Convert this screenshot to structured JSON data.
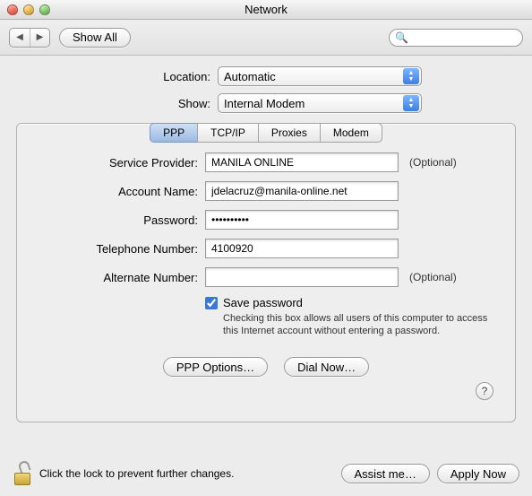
{
  "window": {
    "title": "Network"
  },
  "toolbar": {
    "show_all": "Show All",
    "search_placeholder": ""
  },
  "selectors": {
    "location_label": "Location:",
    "location_value": "Automatic",
    "show_label": "Show:",
    "show_value": "Internal Modem"
  },
  "tabs": {
    "ppp": "PPP",
    "tcpip": "TCP/IP",
    "proxies": "Proxies",
    "modem": "Modem",
    "active": "ppp"
  },
  "form": {
    "service_provider_label": "Service Provider:",
    "service_provider_value": "MANILA ONLINE",
    "account_name_label": "Account Name:",
    "account_name_value": "jdelacruz@manila-online.net",
    "password_label": "Password:",
    "password_value": "••••••••••",
    "telephone_label": "Telephone Number:",
    "telephone_value": "4100920",
    "alternate_label": "Alternate Number:",
    "alternate_value": "",
    "optional": "(Optional)",
    "save_password_label": "Save password",
    "save_password_checked": true,
    "save_password_help": "Checking this box allows all users of this computer to access this Internet account without entering a password.",
    "ppp_options": "PPP Options…",
    "dial_now": "Dial Now…"
  },
  "help": {
    "symbol": "?"
  },
  "footer": {
    "lock_text": "Click the lock to prevent further changes.",
    "assist": "Assist me…",
    "apply": "Apply Now"
  }
}
